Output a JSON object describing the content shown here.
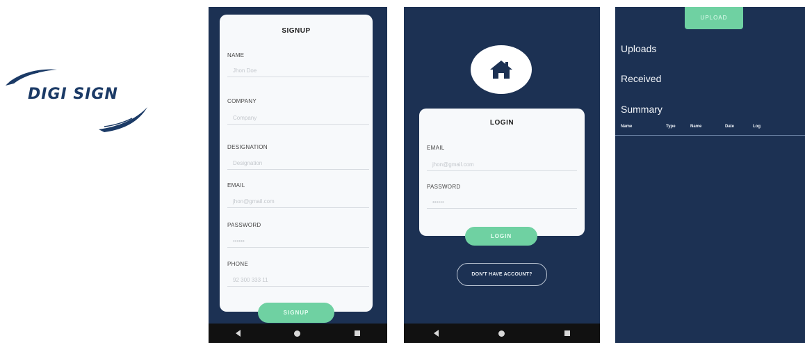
{
  "logo": {
    "text": "DIGI SIGN"
  },
  "signup": {
    "title": "SIGNUP",
    "fields": [
      {
        "label": "NAME",
        "placeholder": "Jhon Doe"
      },
      {
        "label": "COMPANY",
        "placeholder": "Company"
      },
      {
        "label": "DESIGNATION",
        "placeholder": "Designation"
      },
      {
        "label": "EMAIL",
        "placeholder": "jhon@gmail.com"
      },
      {
        "label": "PASSWORD",
        "placeholder": "••••••"
      },
      {
        "label": "PHONE",
        "placeholder": "92 300 333 11"
      }
    ],
    "button": "SIGNUP"
  },
  "login": {
    "title": "LOGIN",
    "fields": [
      {
        "label": "EMAIL",
        "placeholder": "jhon@gmail.com"
      },
      {
        "label": "PASSWORD",
        "placeholder": "••••••"
      }
    ],
    "button": "LOGIN",
    "secondary_button": "DON'T HAVE ACCOUNT?"
  },
  "dashboard": {
    "upload_button": "UPLOAD",
    "menu": [
      "Uploads",
      "Received",
      "Summary"
    ],
    "table_headers": [
      "Name",
      "Type",
      "Name",
      "Date",
      "Log"
    ]
  },
  "colors": {
    "screen_bg": "#1c3153",
    "accent": "#6fd1a2",
    "card_bg": "#f7f9fb",
    "navbar": "#111111"
  }
}
